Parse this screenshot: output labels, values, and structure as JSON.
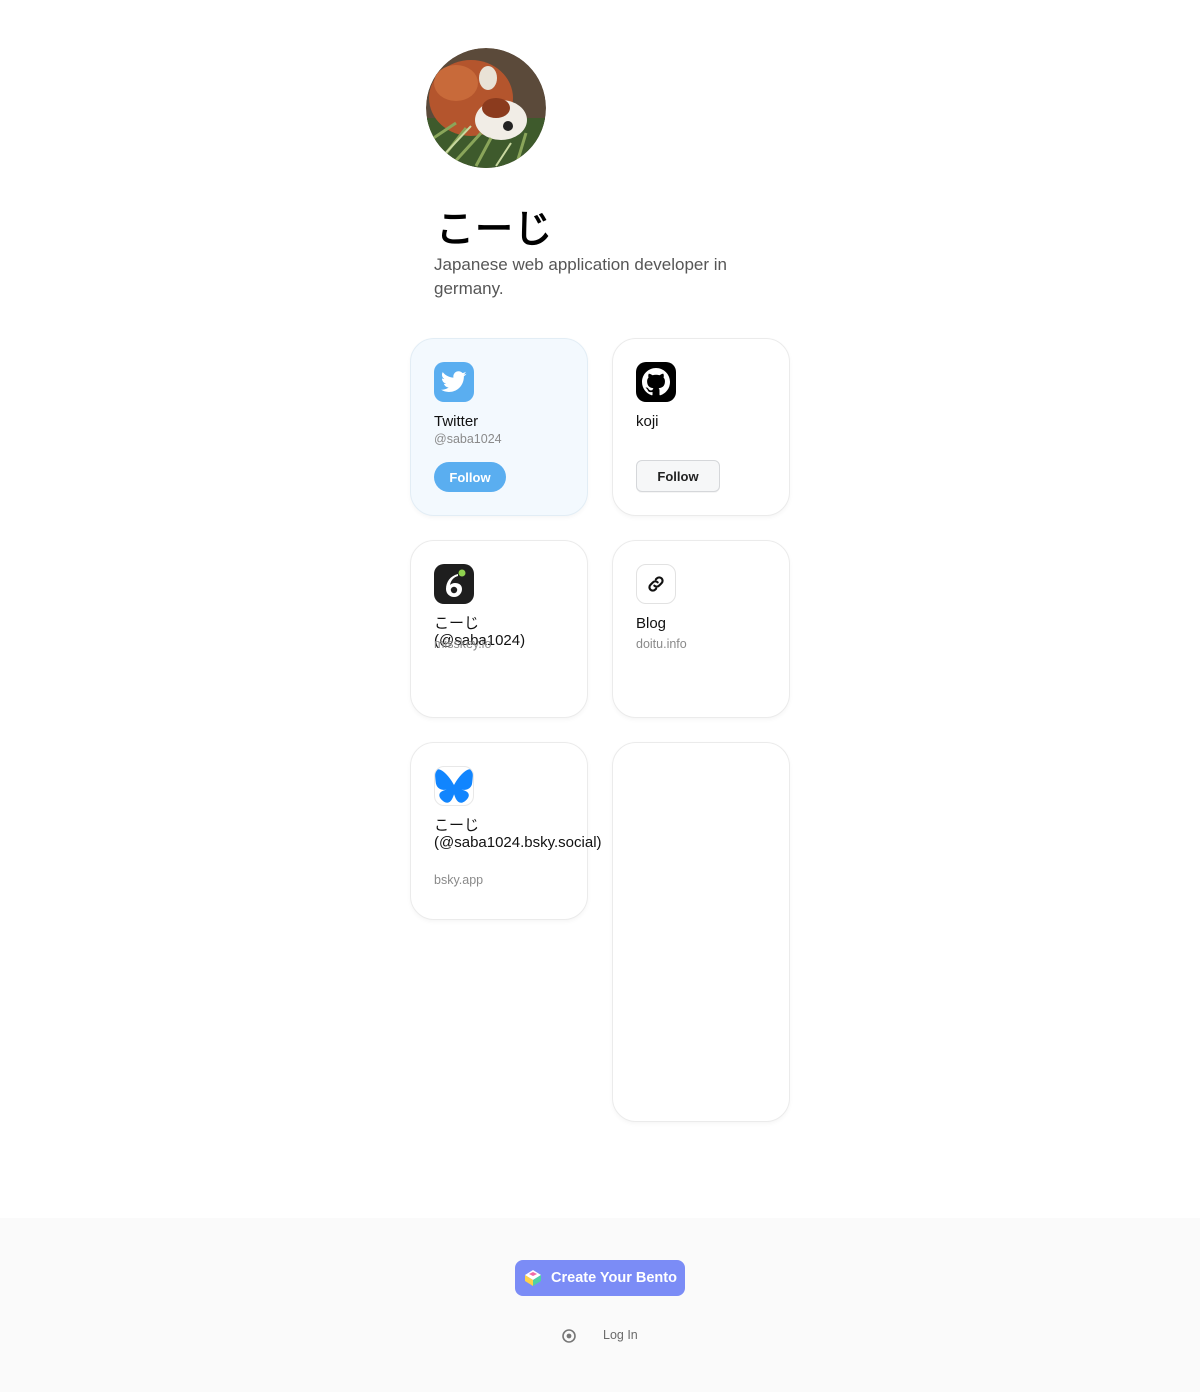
{
  "profile": {
    "name": "こーじ",
    "bio": "Japanese web application developer in germany."
  },
  "cards": {
    "twitter": {
      "title": "Twitter",
      "handle": "@saba1024",
      "button": "Follow",
      "color": "#5aaef0"
    },
    "github": {
      "title": "koji",
      "button": "Follow"
    },
    "misskey": {
      "title": "こーじ (@saba1024)",
      "domain": "misskey.io"
    },
    "blog": {
      "title": "Blog",
      "domain": "doitu.info"
    },
    "bluesky": {
      "title": "こーじ (@saba1024.bsky.social)",
      "domain": "bsky.app",
      "color": "#1185fe"
    }
  },
  "footer": {
    "create_button": "Create Your Bento",
    "login": "Log In",
    "accent": "#7b8cf6"
  },
  "icons": [
    "twitter-icon",
    "github-icon",
    "misskey-icon",
    "link-icon",
    "bluesky-icon",
    "bento-logo-icon",
    "login-icon"
  ]
}
